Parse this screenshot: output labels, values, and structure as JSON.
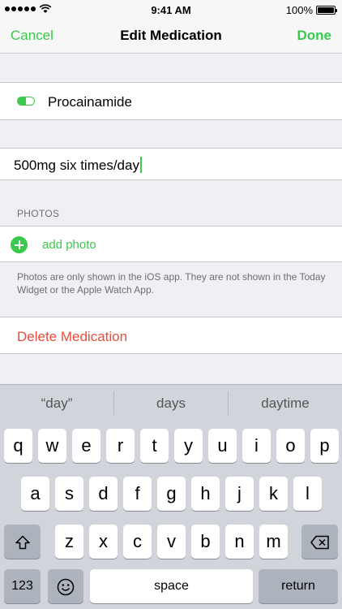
{
  "status": {
    "time": "9:41 AM",
    "battery": "100%"
  },
  "nav": {
    "cancel": "Cancel",
    "title": "Edit Medication",
    "done": "Done"
  },
  "medication": {
    "name": "Procainamide",
    "dose": "500mg six times/day"
  },
  "photos": {
    "header": "PHOTOS",
    "add_label": "add photo",
    "note": "Photos are only shown in the iOS app. They are not shown in the Today Widget or the Apple Watch App."
  },
  "delete_label": "Delete Medication",
  "keyboard": {
    "suggestions": [
      "“day”",
      "days",
      "daytime"
    ],
    "row1": [
      "q",
      "w",
      "e",
      "r",
      "t",
      "y",
      "u",
      "i",
      "o",
      "p"
    ],
    "row2": [
      "a",
      "s",
      "d",
      "f",
      "g",
      "h",
      "j",
      "k",
      "l"
    ],
    "row3": [
      "z",
      "x",
      "c",
      "v",
      "b",
      "n",
      "m"
    ],
    "numbers_label": "123",
    "space_label": "space",
    "return_label": "return",
    "shift_icon": "shift-icon",
    "delete_icon": "backspace-icon",
    "emoji_icon": "emoji-icon"
  },
  "colors": {
    "accent": "#3ac94c",
    "destructive": "#e74c3c"
  }
}
